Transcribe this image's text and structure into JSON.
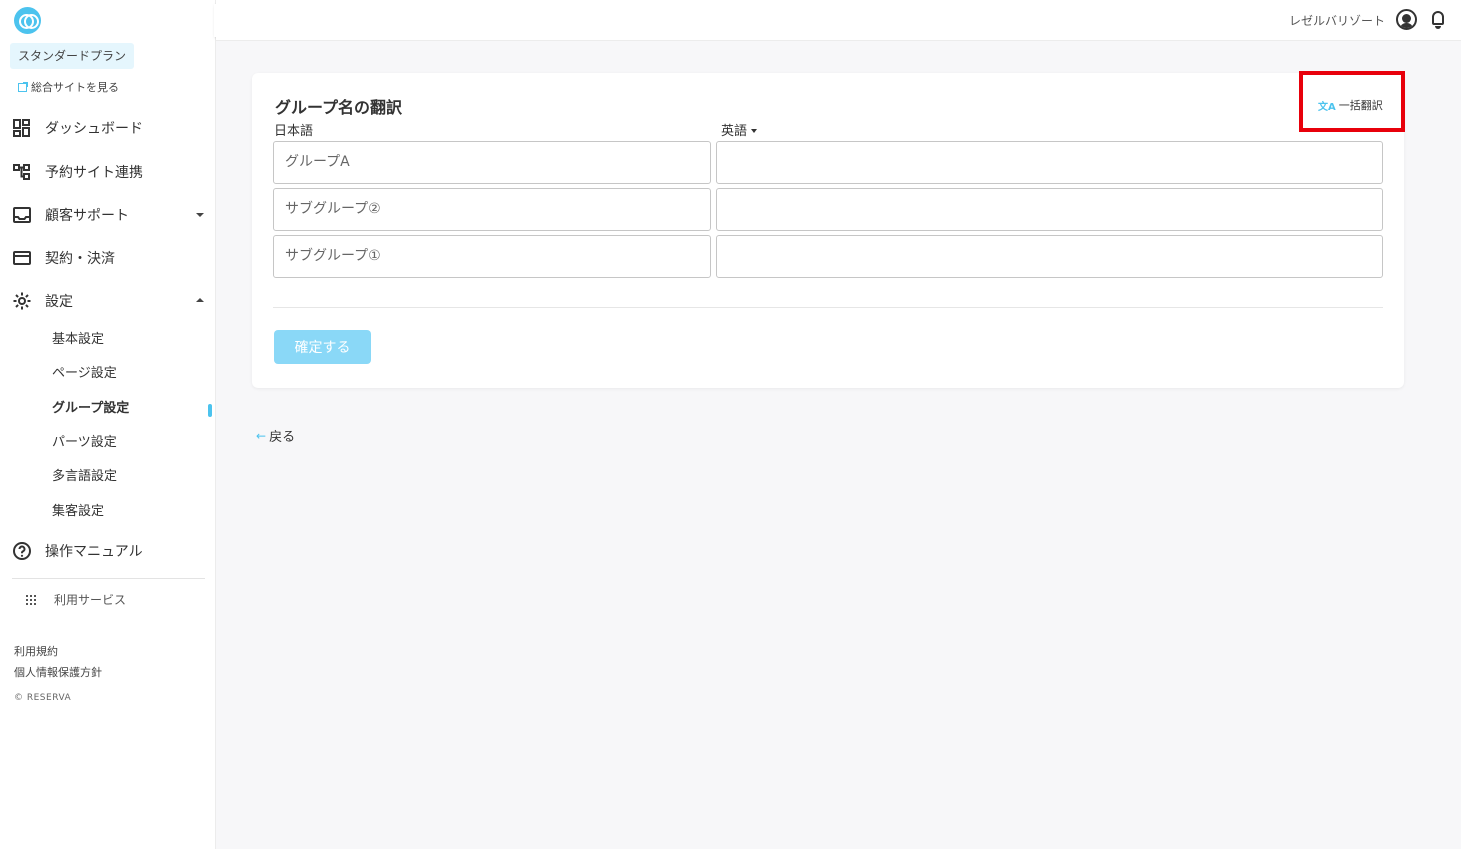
{
  "sidebar": {
    "plan": "スタンダードプラン",
    "site_link": "総合サイトを見る",
    "nav": {
      "dashboard": "ダッシュボード",
      "booking_sites": "予約サイト連携",
      "support": "顧客サポート",
      "billing": "契約・決済",
      "settings": "設定",
      "manual": "操作マニュアル"
    },
    "settings_sub": [
      "基本設定",
      "ページ設定",
      "グループ設定",
      "パーツ設定",
      "多言語設定",
      "集客設定"
    ],
    "services": "利用サービス",
    "terms": "利用規約",
    "privacy": "個人情報保護方針",
    "copyright": "© RESERVA"
  },
  "header": {
    "user_name": "レゼルバリゾート"
  },
  "main": {
    "title": "グループ名の翻訳",
    "bulk_translate": "一括翻訳",
    "bulk_icon": "文A",
    "col_source": "日本語",
    "col_target": "英語",
    "rows": [
      {
        "ja": "グループA",
        "en": ""
      },
      {
        "ja": "サブグループ②",
        "en": ""
      },
      {
        "ja": "サブグループ①",
        "en": ""
      }
    ],
    "confirm": "確定する",
    "back": "戻る"
  },
  "colors": {
    "accent": "#4cc3ee",
    "confirm_button": "#8ad8f7",
    "highlight": "#e8000b"
  }
}
